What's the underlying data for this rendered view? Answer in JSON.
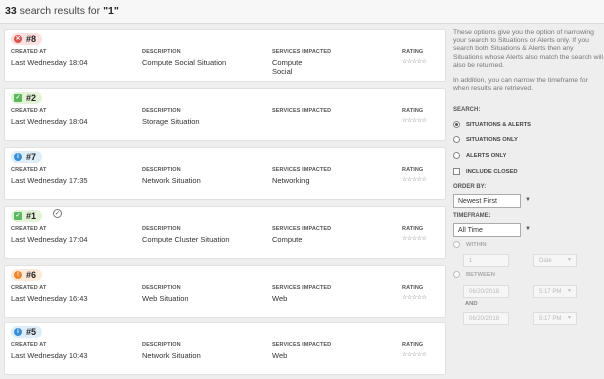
{
  "header": {
    "count": "33",
    "text": " search results for ",
    "query": "\"1\""
  },
  "columns": {
    "created": "CREATED AT",
    "description": "DESCRIPTION",
    "services": "SERVICES IMPACTED",
    "rating": "RATING"
  },
  "results": [
    {
      "id": "#8",
      "severity": "critical",
      "created": "Last Wednesday 18:04",
      "description": "Compute Social Situation",
      "services_1": "Compute",
      "services_2": "Social",
      "rating": "☆☆☆☆☆"
    },
    {
      "id": "#2",
      "severity": "ok",
      "created": "Last Wednesday 18:04",
      "description": "Storage Situation",
      "services_1": "",
      "services_2": "",
      "rating": "☆☆☆☆☆"
    },
    {
      "id": "#7",
      "severity": "info",
      "created": "Last Wednesday 17:35",
      "description": "Network Situation",
      "services_1": "Networking",
      "services_2": "",
      "rating": "☆☆☆☆☆"
    },
    {
      "id": "#1",
      "severity": "ok",
      "created": "Last Wednesday 17:04",
      "description": "Compute Cluster Situation",
      "services_1": "Compute",
      "services_2": "",
      "rating": "☆☆☆☆☆"
    },
    {
      "id": "#6",
      "severity": "warning",
      "created": "Last Wednesday 16:43",
      "description": "Web Situation",
      "services_1": "Web",
      "services_2": "",
      "rating": "☆☆☆☆☆"
    },
    {
      "id": "#5",
      "severity": "info",
      "created": "Last Wednesday 10:43",
      "description": "Network Situation",
      "services_1": "Web",
      "services_2": "",
      "rating": "☆☆☆☆☆"
    }
  ],
  "sidebar": {
    "help_1": "These options give you the option of narrowing your search to Situations or Alerts only. If you search both Situations & Alerts then any Situations whose Alerts also match the search will also be returned.",
    "help_2": "In addition, you can narrow the timeframe for when results are retrieved.",
    "search_label": "SEARCH:",
    "search_options": [
      "SITUATIONS & ALERTS",
      "SITUATIONS ONLY",
      "ALERTS ONLY"
    ],
    "search_selected": "SITUATIONS & ALERTS",
    "include_closed": "INCLUDE CLOSED",
    "include_closed_checked": false,
    "order_label": "ORDER BY:",
    "order_value": "Newest First",
    "timeframe_label": "TIMEFRAME:",
    "timeframe_value": "All Time",
    "within_label": "WITHIN",
    "within_number": "1",
    "within_unit": "Date",
    "between_label": "BETWEEN",
    "and_label": "AND",
    "from_date": "06/20/2018",
    "from_time": "5:17 PM",
    "to_date": "06/20/2018",
    "to_time": "5:17 PM"
  },
  "colors": {
    "critical": "#d9534f",
    "ok": "#5cb85c",
    "info": "#3a8fd6",
    "warning": "#f0862c"
  }
}
